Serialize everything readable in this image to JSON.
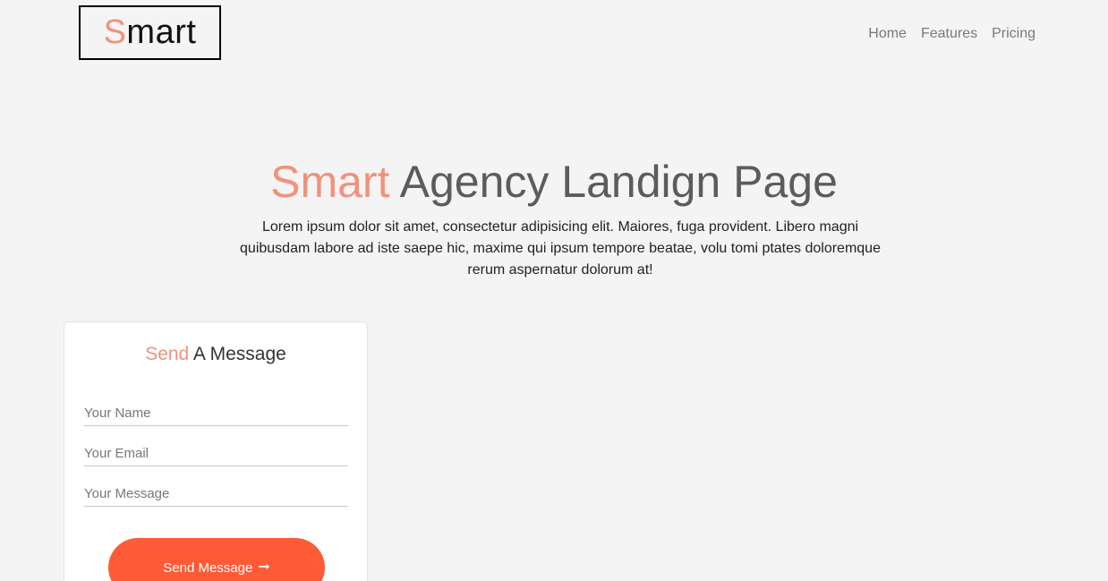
{
  "header": {
    "logo_first_letter": "S",
    "logo_rest": "mart",
    "nav": [
      {
        "label": "Home"
      },
      {
        "label": "Features"
      },
      {
        "label": "Pricing"
      }
    ]
  },
  "hero": {
    "title_accent": "Smart",
    "title_rest": " Agency Landign Page",
    "text": "Lorem ipsum dolor sit amet, consectetur adipisicing elit. Maiores, fuga provident. Libero magni quibusdam labore ad iste saepe hic, maxime qui ipsum tempore beatae, volu tomi ptates doloremque rerum aspernatur dolorum at!"
  },
  "contact": {
    "title_accent": "Send",
    "title_rest": " A Message",
    "name_placeholder": "Your Name",
    "email_placeholder": "Your Email",
    "message_placeholder": "Your Message",
    "submit_label": "Send Message",
    "submit_icon": "arrow-right-icon"
  },
  "colors": {
    "accent": "#f1927c",
    "button": "#fe5b36",
    "background": "#f4f4f4"
  }
}
